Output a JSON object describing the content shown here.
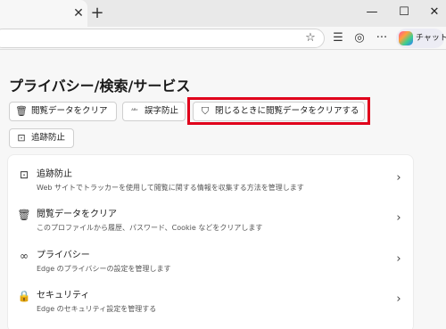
{
  "browser": {
    "tab_close_glyph": "✕",
    "new_tab_glyph": "+",
    "window": {
      "minimize": "—",
      "maximize": "☐",
      "close": "✕"
    },
    "toolbar": {
      "star": "☆",
      "collections": "☰",
      "profile": "◎",
      "more": "···",
      "copilot_label": "チャット"
    }
  },
  "settings": {
    "page_title": "プライバシー/検索/サービス",
    "quick_actions": [
      {
        "label": "閲覧データをクリア",
        "icon": "trash-icon",
        "glyph": "🗑"
      },
      {
        "label": "誤字防止",
        "icon": "spellcheck-icon",
        "glyph": "ᴬᴮᶜ"
      },
      {
        "label": "閉じるときに閲覧データをクリアする",
        "icon": "shield-clock-icon",
        "glyph": "⛉"
      },
      {
        "label": "追跡防止",
        "icon": "tracking-prevention-icon",
        "glyph": "⊡"
      }
    ],
    "highlight_color": "#e0001b",
    "sections": [
      {
        "title": "追跡防止",
        "desc": "Web サイトでトラッカーを使用して閲覧に関する情報を収集する方法を管理します",
        "icon": "tracking-prevention-icon",
        "glyph": "⊡"
      },
      {
        "title": "閲覧データをクリア",
        "desc": "このプロファイルから履歴、パスワード、Cookie などをクリアします",
        "icon": "trash-icon",
        "glyph": "🗑"
      },
      {
        "title": "プライバシー",
        "desc": "Edge のプライバシーの設定を管理します",
        "icon": "glasses-icon",
        "glyph": "∞"
      },
      {
        "title": "セキュリティ",
        "desc": "Edge のセキュリティ設定を管理する",
        "icon": "lock-icon",
        "glyph": "🔒"
      }
    ],
    "chevron": "›"
  }
}
